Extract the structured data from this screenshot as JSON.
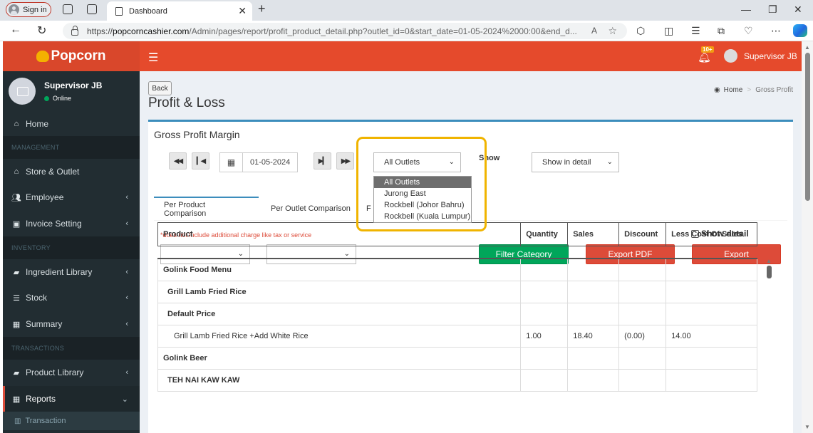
{
  "browser": {
    "signin_label": "Sign in",
    "tab_title": "Dashboard",
    "url_prefix": "https://",
    "url_host": "popcorncashier.com",
    "url_path": "/Admin/pages/report/profit_product_detail.php?outlet_id=0&start_date=01-05-2024%2000:00&end_d..."
  },
  "app": {
    "brand": "Popcorn",
    "header_user": "Supervisor JB",
    "notification_badge": "10+"
  },
  "sidebar": {
    "user_name": "Supervisor JB",
    "user_status": "Online",
    "home": "Home",
    "management_header": "MANAGEMENT",
    "store_outlet": "Store & Outlet",
    "employee": "Employee",
    "invoice_setting": "Invoice Setting",
    "inventory_header": "INVENTORY",
    "ingredient_library": "Ingredient Library",
    "stock": "Stock",
    "summary": "Summary",
    "transactions_header": "TRANSACTIONS",
    "product_library": "Product Library",
    "reports": "Reports",
    "transaction_sub": "Transaction"
  },
  "page": {
    "back_label": "Back",
    "title": "Profit & Loss",
    "breadcrumb_home": "Home",
    "breadcrumb_current": "Gross Profit",
    "box_title": "Gross Profit Margin",
    "date_value": "01-05-2024",
    "outlet_selected": "All Outlets",
    "outlet_options": [
      "All Outlets",
      "Jurong East",
      "Rockbell (Johor Bahru)",
      "Rockbell (Kuala Lumpur)"
    ],
    "show_label": "Show",
    "show_select": "Show in detail",
    "tab_product": "Per Product Comparison",
    "tab_outlet": "Per Outlet Comparison",
    "tab_third_partial": "F",
    "note": "*does not include additional charge like tax or service",
    "show_detail_label": "Show detail",
    "filter_category": "Filter Category",
    "export_pdf": "Export PDF",
    "export": "Export"
  },
  "table": {
    "headers": [
      "Product",
      "Quantity",
      "Sales",
      "Discount",
      "Less Cost Of Sales"
    ],
    "rows": [
      {
        "product": "Golink Food Menu",
        "quantity": "",
        "sales": "",
        "discount": "",
        "less_cost": ""
      },
      {
        "product": "Grill Lamb Fried Rice",
        "quantity": "",
        "sales": "",
        "discount": "",
        "less_cost": ""
      },
      {
        "product": "Default Price",
        "quantity": "",
        "sales": "",
        "discount": "",
        "less_cost": ""
      },
      {
        "product": "Grill Lamb Fried Rice +Add White Rice",
        "quantity": "1.00",
        "sales": "18.40",
        "discount": "(0.00)",
        "less_cost": "14.00"
      },
      {
        "product": "Golink Beer",
        "quantity": "",
        "sales": "",
        "discount": "",
        "less_cost": ""
      },
      {
        "product": "TEH NAI KAW KAW",
        "quantity": "",
        "sales": "",
        "discount": "",
        "less_cost": ""
      }
    ]
  }
}
